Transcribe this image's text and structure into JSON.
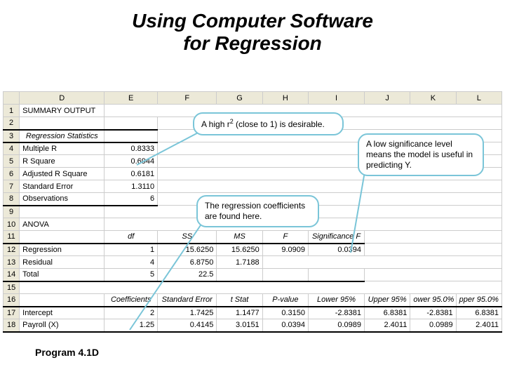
{
  "title_line1": "Using Computer Software",
  "title_line2": "for Regression",
  "footer": "Program 4.1D",
  "columns": [
    "D",
    "E",
    "F",
    "G",
    "H",
    "I",
    "J",
    "K",
    "L"
  ],
  "rows": {
    "r1": {
      "d": "SUMMARY OUTPUT"
    },
    "r3": {
      "d": "Regression Statistics"
    },
    "r4": {
      "d": "Multiple R",
      "e": "0.8333"
    },
    "r5": {
      "d": "R Square",
      "e": "0.6944"
    },
    "r6": {
      "d": "Adjusted R Square",
      "e": "0.6181"
    },
    "r7": {
      "d": "Standard Error",
      "e": "1.3110"
    },
    "r8": {
      "d": "Observations",
      "e": "6"
    },
    "r10": {
      "d": "ANOVA"
    },
    "r11": {
      "e": "df",
      "f": "SS",
      "g": "MS",
      "h": "F",
      "i": "Significance F"
    },
    "r12": {
      "d": "Regression",
      "e": "1",
      "f": "15.6250",
      "g": "15.6250",
      "h": "9.0909",
      "i": "0.0394"
    },
    "r13": {
      "d": "Residual",
      "e": "4",
      "f": "6.8750",
      "g": "1.7188"
    },
    "r14": {
      "d": "Total",
      "e": "5",
      "f": "22.5"
    },
    "r16": {
      "e": "Coefficients",
      "f": "Standard Error",
      "g": "t Stat",
      "h": "P-value",
      "i": "Lower 95%",
      "j": "Upper 95%",
      "k": "ower 95.0%",
      "l": "pper 95.0%"
    },
    "r17": {
      "d": "Intercept",
      "e": "2",
      "f": "1.7425",
      "g": "1.1477",
      "h": "0.3150",
      "i": "-2.8381",
      "j": "6.8381",
      "k": "-2.8381",
      "l": "6.8381"
    },
    "r18": {
      "d": "Payroll (X)",
      "e": "1.25",
      "f": "0.4145",
      "g": "3.0151",
      "h": "0.0394",
      "i": "0.0989",
      "j": "2.4011",
      "k": "0.0989",
      "l": "2.4011"
    }
  },
  "callouts": {
    "c1_pre": "A high r",
    "c1_sup": "2",
    "c1_post": " (close to 1) is desirable.",
    "c2": "A low significance level means the model is useful in predicting Y.",
    "c3": "The regression coefficients are found here."
  }
}
